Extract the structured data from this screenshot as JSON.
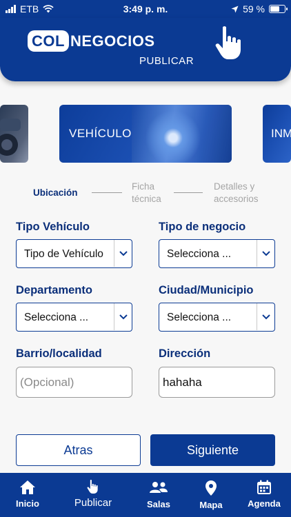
{
  "status_bar": {
    "carrier": "ETB",
    "time": "3:49 p. m.",
    "battery": "59 %",
    "battery_level": 0.59
  },
  "header": {
    "logo_part1": "COL",
    "logo_part2": "NEGOCIOS",
    "subtitle": "PUBLICAR"
  },
  "categories": [
    {
      "label": ""
    },
    {
      "label": "VEHÍCULO"
    },
    {
      "label": "INMUEBLE"
    }
  ],
  "steps": [
    {
      "line1": "Ubicación",
      "line2": "",
      "active": true
    },
    {
      "line1": "Ficha",
      "line2": "técnica",
      "active": false
    },
    {
      "line1": "Detalles y",
      "line2": "accesorios",
      "active": false
    }
  ],
  "form": {
    "tipo_vehiculo": {
      "label": "Tipo Vehículo",
      "value": "Tipo de Vehículo"
    },
    "tipo_negocio": {
      "label": "Tipo de negocio",
      "value": "Selecciona ..."
    },
    "departamento": {
      "label": "Departamento",
      "value": "Selecciona ..."
    },
    "ciudad": {
      "label": "Ciudad/Municipio",
      "value": "Selecciona ..."
    },
    "barrio": {
      "label": "Barrio/localidad",
      "value": "",
      "placeholder": "(Opcional)"
    },
    "direccion": {
      "label": "Dirección",
      "value": "hahaha"
    }
  },
  "buttons": {
    "back": "Atras",
    "next": "Siguiente"
  },
  "nav": [
    {
      "label": "Inicio",
      "icon": "home-icon"
    },
    {
      "label": "Publicar",
      "icon": "hand-pointer-icon"
    },
    {
      "label": "Salas",
      "icon": "users-icon"
    },
    {
      "label": "Mapa",
      "icon": "map-pin-icon"
    },
    {
      "label": "Agenda",
      "icon": "calendar-icon"
    }
  ],
  "colors": {
    "primary": "#0b3a93",
    "text_dark": "#0b2f7a",
    "muted": "#a5a5a5",
    "background": "#f7f7f7"
  }
}
